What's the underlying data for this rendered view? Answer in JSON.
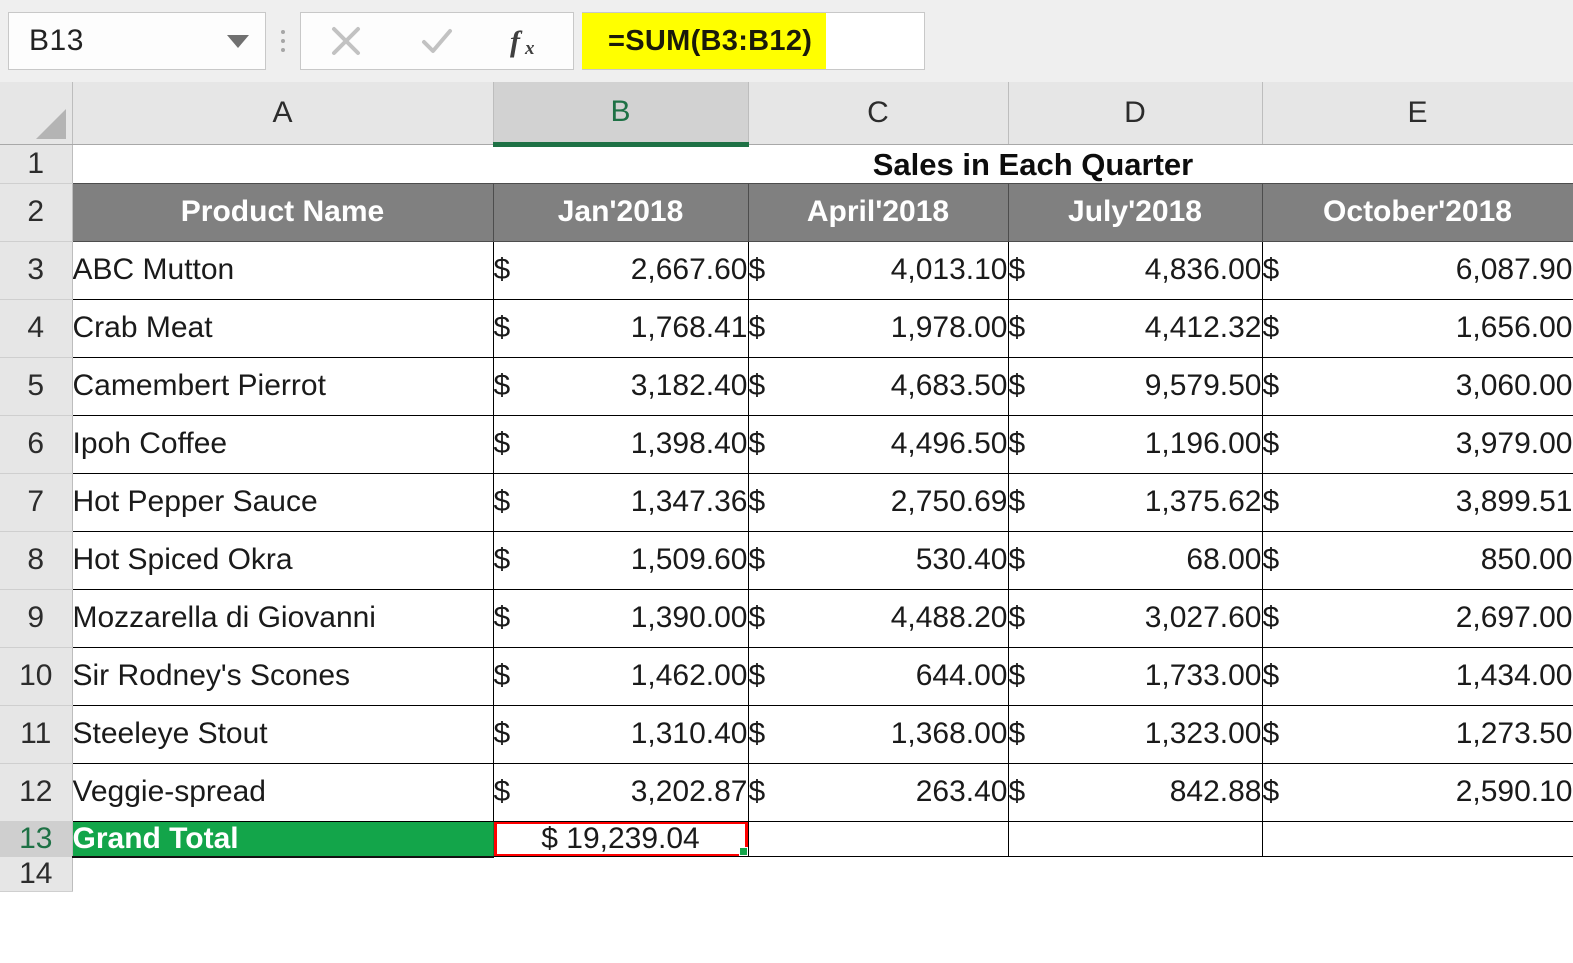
{
  "formula_bar": {
    "name_box_value": "B13",
    "name_box_dropdown_icon": "chevron-down-icon",
    "grip_icon": "vertical-dots-grip-icon",
    "cancel_icon": "close-x-icon",
    "confirm_icon": "check-icon",
    "function_icon": "fx-insert-function-icon",
    "formula_value": "=SUM(B3:B12)",
    "formula_highlight_color": "#ffff00"
  },
  "sheet": {
    "select_all_icon": "select-all-corner-triangle-icon",
    "column_headers": [
      "A",
      "B",
      "C",
      "D",
      "E"
    ],
    "selected_column": "B",
    "selected_column_accent": "#1e7145",
    "row_headers": [
      "1",
      "2",
      "3",
      "4",
      "5",
      "6",
      "7",
      "8",
      "9",
      "10",
      "11",
      "12",
      "13",
      "14"
    ],
    "selected_row": "13",
    "title": "Sales in Each Quarter",
    "table_headers": [
      "Product Name",
      "Jan'2018",
      "April'2018",
      "July'2018",
      "October'2018"
    ],
    "header_bg_color": "#808080",
    "rows": [
      {
        "row": "3",
        "name": "ABC Mutton",
        "jan": "2,667.60",
        "apr": "4,013.10",
        "jul": "4,836.00",
        "oct": "6,087.90"
      },
      {
        "row": "4",
        "name": "Crab Meat",
        "jan": "1,768.41",
        "apr": "1,978.00",
        "jul": "4,412.32",
        "oct": "1,656.00"
      },
      {
        "row": "5",
        "name": "Camembert Pierrot",
        "jan": "3,182.40",
        "apr": "4,683.50",
        "jul": "9,579.50",
        "oct": "3,060.00"
      },
      {
        "row": "6",
        "name": "Ipoh Coffee",
        "jan": "1,398.40",
        "apr": "4,496.50",
        "jul": "1,196.00",
        "oct": "3,979.00"
      },
      {
        "row": "7",
        "name": "Hot Pepper Sauce",
        "jan": "1,347.36",
        "apr": "2,750.69",
        "jul": "1,375.62",
        "oct": "3,899.51"
      },
      {
        "row": "8",
        "name": " Hot Spiced Okra",
        "jan": "1,509.60",
        "apr": "530.40",
        "jul": "68.00",
        "oct": "850.00"
      },
      {
        "row": "9",
        "name": "Mozzarella di Giovanni",
        "jan": "1,390.00",
        "apr": "4,488.20",
        "jul": "3,027.60",
        "oct": "2,697.00"
      },
      {
        "row": "10",
        "name": "Sir Rodney's Scones",
        "jan": "1,462.00",
        "apr": "644.00",
        "jul": "1,733.00",
        "oct": "1,434.00"
      },
      {
        "row": "11",
        "name": "Steeleye Stout",
        "jan": "1,310.40",
        "apr": "1,368.00",
        "jul": "1,323.00",
        "oct": "1,273.50"
      },
      {
        "row": "12",
        "name": "Veggie-spread",
        "jan": "3,202.87",
        "apr": "263.40",
        "jul": "842.88",
        "oct": "2,590.10"
      }
    ],
    "currency_symbol": "$",
    "total": {
      "label": "Grand Total",
      "value": "$ 19,239.04",
      "label_bg_color": "#13a54a",
      "selection_border_color": "#ff0000",
      "fill_handle_icon": "fill-handle-icon"
    }
  }
}
